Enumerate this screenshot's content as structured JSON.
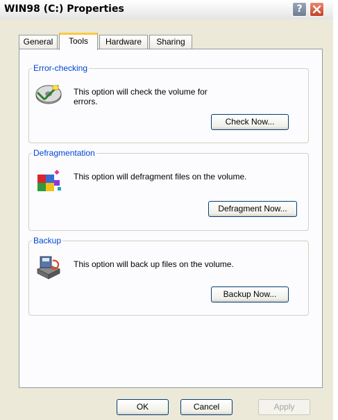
{
  "window": {
    "title": "WIN98 (C:) Properties",
    "help_icon": "question-mark-icon",
    "close_icon": "close-x-icon"
  },
  "tabs": [
    {
      "label": "General",
      "active": false
    },
    {
      "label": "Tools",
      "active": true
    },
    {
      "label": "Hardware",
      "active": false
    },
    {
      "label": "Sharing",
      "active": false
    }
  ],
  "groups": {
    "error_checking": {
      "title": "Error-checking",
      "text_line1": "This option will check the volume for",
      "text_line2": "errors.",
      "button": "Check Now...",
      "icon": "disk-check-icon"
    },
    "defragmentation": {
      "title": "Defragmentation",
      "text": "This option will defragment files on the volume.",
      "button": "Defragment Now...",
      "icon": "defrag-icon"
    },
    "backup": {
      "title": "Backup",
      "text": "This option will back up files on the volume.",
      "button": "Backup Now...",
      "icon": "backup-icon"
    }
  },
  "buttons": {
    "ok": "OK",
    "cancel": "Cancel",
    "apply": "Apply"
  },
  "colors": {
    "group_title": "#0046d5",
    "active_tab_accent": "#ffc83c",
    "close_button": "#c4412a"
  }
}
